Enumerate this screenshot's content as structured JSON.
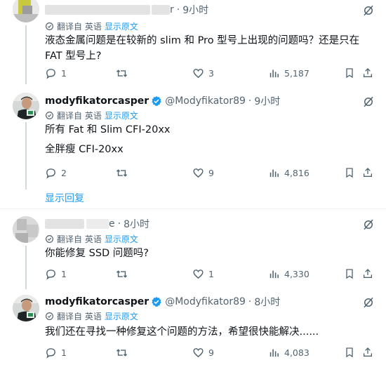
{
  "tweets": [
    {
      "name": "",
      "handle_tail": "r",
      "dot": "·",
      "time": "9小时",
      "translate_label": "翻译自 英语",
      "translate_link": "显示原文",
      "text": "液态金属问题是在较新的 slim 和 Pro 型号上出现的问题吗？还是只在 FAT 型号上?",
      "replies": "1",
      "retweets": "",
      "likes": "3",
      "views": "5,187"
    },
    {
      "name": "modyfikatorcasper",
      "handle": "@Modyfikator89",
      "dot": "·",
      "time": "9小时",
      "translate_label": "翻译自 英语",
      "translate_link": "显示原文",
      "text_line1": "所有 Fat 和 Slim CFI-20xx",
      "text_line2": "全胖瘦 CFI-20xx",
      "replies": "2",
      "retweets": "",
      "likes": "9",
      "views": "4,816"
    },
    {
      "name": "",
      "handle_tail": "e",
      "dot": "·",
      "time": "8小时",
      "translate_label": "翻译自 英语",
      "translate_link": "显示原文",
      "text": "你能修复 SSD 问题吗?",
      "replies": "1",
      "retweets": "",
      "likes": "1",
      "views": "4,330"
    },
    {
      "name": "modyfikatorcasper",
      "handle": "@Modyfikator89",
      "dot": "·",
      "time": "8小时",
      "translate_label": "翻译自 英语",
      "translate_link": "显示原文",
      "text": "我们还在寻找一种修复这个问题的方法，希望很快能解决......",
      "replies": "1",
      "retweets": "",
      "likes": "9",
      "views": "4,083"
    }
  ],
  "show_replies": "显示回复",
  "colors": {
    "accent": "#1d9bf0",
    "muted": "#536471",
    "text": "#0f1419",
    "divider": "#eff3f4"
  },
  "icons": [
    "grok-icon",
    "translate-icon",
    "verified-badge-icon",
    "reply-icon",
    "retweet-icon",
    "like-icon",
    "views-icon",
    "bookmark-icon",
    "share-icon",
    "more-icon"
  ]
}
